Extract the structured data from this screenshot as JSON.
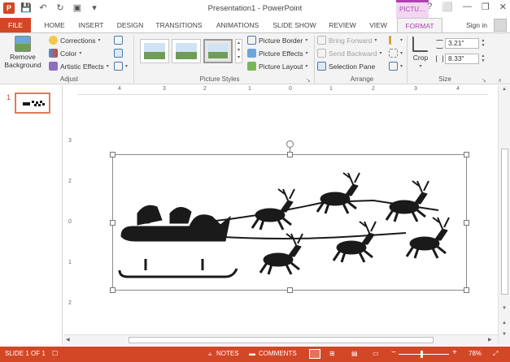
{
  "window": {
    "title": "Presentation1 - PowerPoint",
    "context_tab": "PICTU…",
    "sign_in": "Sign in"
  },
  "tabs": [
    "FILE",
    "HOME",
    "INSERT",
    "DESIGN",
    "TRANSITIONS",
    "ANIMATIONS",
    "SLIDE SHOW",
    "REVIEW",
    "VIEW",
    "FORMAT"
  ],
  "ribbon": {
    "adjust": {
      "remove_bg_line1": "Remove",
      "remove_bg_line2": "Background",
      "corrections": "Corrections",
      "color": "Color",
      "artistic_effects": "Artistic Effects",
      "label": "Adjust"
    },
    "picture_styles": {
      "border": "Picture Border",
      "effects": "Picture Effects",
      "layout": "Picture Layout",
      "label": "Picture Styles"
    },
    "arrange": {
      "bring_forward": "Bring Forward",
      "send_backward": "Send Backward",
      "selection_pane": "Selection Pane",
      "label": "Arrange"
    },
    "size": {
      "crop": "Crop",
      "height": "3.21\"",
      "width": "8.33\"",
      "label": "Size"
    }
  },
  "thumbnails": {
    "slide_number": "1"
  },
  "hruler_numbers": [
    "4",
    "3",
    "2",
    "1",
    "0",
    "1",
    "2",
    "3",
    "4"
  ],
  "vruler_numbers": [
    "3",
    "2",
    "1",
    "0",
    "1",
    "2",
    "3"
  ],
  "statusbar": {
    "slide_info": "SLIDE 1 OF 1",
    "notes": "NOTES",
    "comments": "COMMENTS",
    "zoom": "78%"
  },
  "colors": {
    "accent": "#d24726",
    "context": "#b140b1",
    "silhouette": "#1a1a1a"
  }
}
